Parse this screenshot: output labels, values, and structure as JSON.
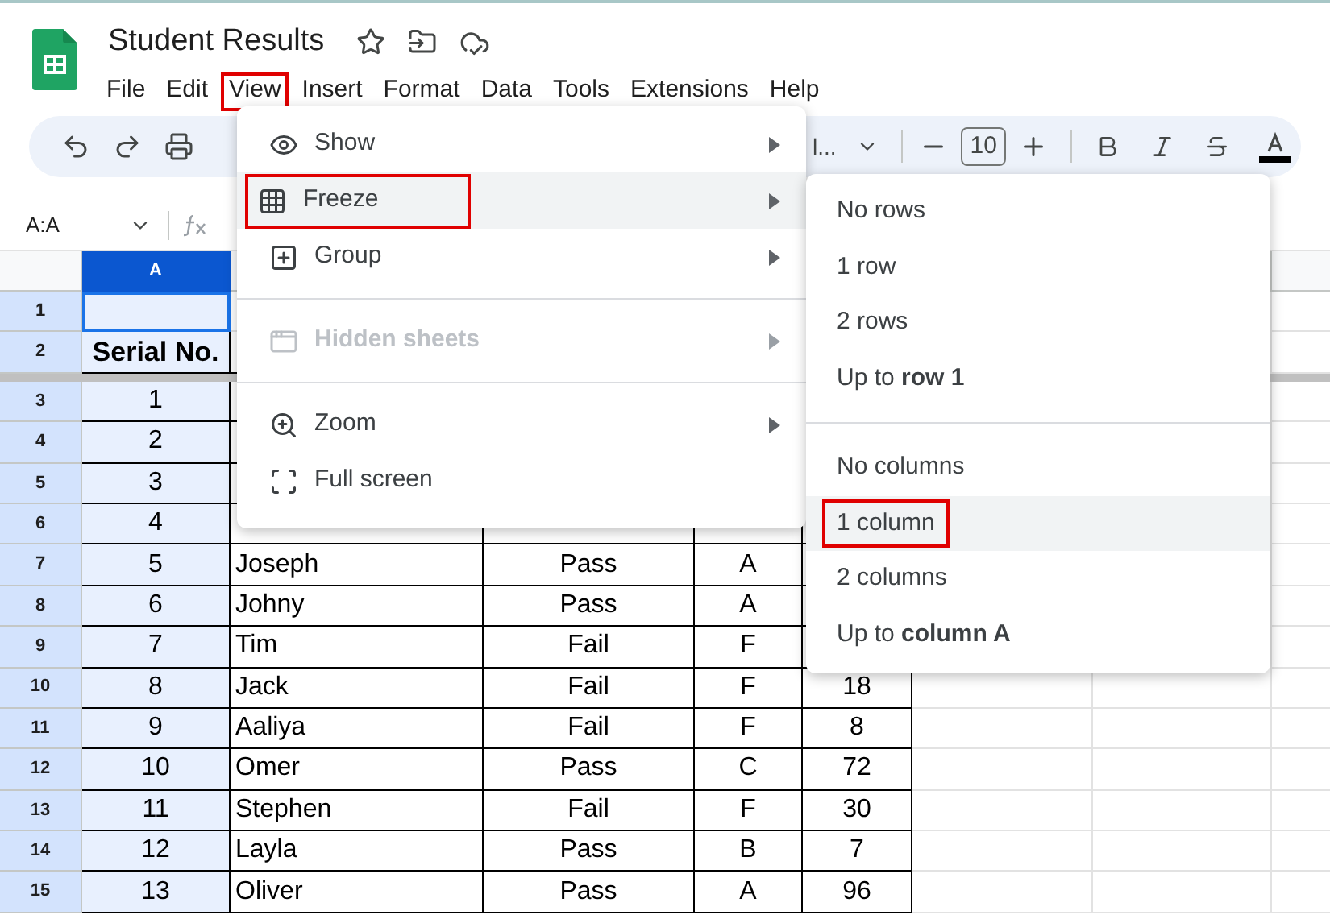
{
  "document": {
    "title": "Student Results"
  },
  "menu_bar": [
    {
      "label": "File",
      "selected": false
    },
    {
      "label": "Edit",
      "selected": false
    },
    {
      "label": "View",
      "selected": true
    },
    {
      "label": "Insert",
      "selected": false
    },
    {
      "label": "Format",
      "selected": false
    },
    {
      "label": "Data",
      "selected": false
    },
    {
      "label": "Tools",
      "selected": false
    },
    {
      "label": "Extensions",
      "selected": false
    },
    {
      "label": "Help",
      "selected": false
    }
  ],
  "toolbar": {
    "font": "l...",
    "font_size": "10"
  },
  "formula_bar": {
    "name_box": "A:A"
  },
  "grid": {
    "columns": [
      {
        "label": "A",
        "selected": true
      }
    ],
    "rows": [
      {
        "number": "1",
        "cells": []
      },
      {
        "number": "2",
        "cells": [
          "Serial No."
        ]
      },
      {
        "number": "3",
        "cells": [
          "1"
        ]
      },
      {
        "number": "4",
        "cells": [
          "2"
        ]
      },
      {
        "number": "5",
        "cells": [
          "3"
        ]
      },
      {
        "number": "6",
        "cells": [
          "4"
        ]
      },
      {
        "number": "7",
        "cells": [
          "5",
          "Joseph",
          "Pass",
          "A"
        ]
      },
      {
        "number": "8",
        "cells": [
          "6",
          "Johny",
          "Pass",
          "A"
        ]
      },
      {
        "number": "9",
        "cells": [
          "7",
          "Tim",
          "Fail",
          "F"
        ]
      },
      {
        "number": "10",
        "cells": [
          "8",
          "Jack",
          "Fail",
          "F",
          "18"
        ]
      },
      {
        "number": "11",
        "cells": [
          "9",
          "Aaliya",
          "Fail",
          "F",
          "8"
        ]
      },
      {
        "number": "12",
        "cells": [
          "10",
          "Omer",
          "Pass",
          "C",
          "72"
        ]
      },
      {
        "number": "13",
        "cells": [
          "11",
          "Stephen",
          "Fail",
          "F",
          "30"
        ]
      },
      {
        "number": "14",
        "cells": [
          "12",
          "Layla",
          "Pass",
          "B",
          "7"
        ]
      },
      {
        "number": "15",
        "cells": [
          "13",
          "Oliver",
          "Pass",
          "A",
          "96"
        ]
      }
    ]
  },
  "view_menu": [
    {
      "kind": "item",
      "label": "Show",
      "submenu": true,
      "disabled": false,
      "selected": false
    },
    {
      "kind": "item",
      "label": "Freeze",
      "submenu": true,
      "disabled": false,
      "selected": true
    },
    {
      "kind": "item",
      "label": "Group",
      "submenu": true,
      "disabled": false,
      "selected": false
    },
    {
      "kind": "divider"
    },
    {
      "kind": "item",
      "label": "Hidden sheets",
      "submenu": true,
      "disabled": true,
      "selected": false
    },
    {
      "kind": "divider"
    },
    {
      "kind": "item",
      "label": "Zoom",
      "submenu": true,
      "disabled": false,
      "selected": false
    },
    {
      "kind": "item",
      "label": "Full screen",
      "submenu": false,
      "disabled": false,
      "selected": false
    }
  ],
  "freeze_submenu": [
    {
      "kind": "item",
      "label": "No rows",
      "selected": false
    },
    {
      "kind": "item",
      "label": "1 row",
      "selected": false
    },
    {
      "kind": "item",
      "label": "2 rows",
      "selected": false
    },
    {
      "kind": "item",
      "label": "Up to **row 1**",
      "selected": false
    },
    {
      "kind": "divider"
    },
    {
      "kind": "item",
      "label": "No columns",
      "selected": false
    },
    {
      "kind": "item",
      "label": "1 column",
      "selected": true
    },
    {
      "kind": "item",
      "label": "2 columns",
      "selected": false
    },
    {
      "kind": "item",
      "label": "Up to **column A**",
      "selected": false
    }
  ]
}
